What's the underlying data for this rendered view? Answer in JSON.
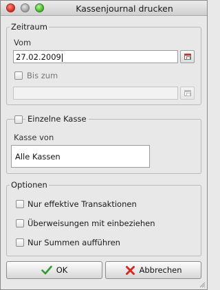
{
  "window": {
    "title": "Kassenjournal drucken"
  },
  "zeitraum": {
    "legend": "Zeitraum",
    "vom_label": "Vom",
    "vom_value": "27.02.2009",
    "bis_checkbox_label": "Bis zum",
    "bis_checked": false,
    "bis_value": ""
  },
  "kasse": {
    "checkbox_label": "Einzelne Kasse",
    "checked": false,
    "von_label": "Kasse von",
    "von_value": "Alle Kassen"
  },
  "optionen": {
    "legend": "Optionen",
    "items": [
      {
        "label": "Nur effektive Transaktionen",
        "checked": false
      },
      {
        "label": "Überweisungen mit einbeziehen",
        "checked": false
      },
      {
        "label": "Nur Summen aufführen",
        "checked": false
      }
    ]
  },
  "buttons": {
    "ok": "OK",
    "cancel": "Abbrechen"
  },
  "icons": {
    "ok": "checkmark-icon",
    "cancel": "x-icon",
    "calendar": "calendar-icon"
  },
  "colors": {
    "ok_check": "#2e9a2e",
    "cancel_x": "#d42a1e"
  }
}
